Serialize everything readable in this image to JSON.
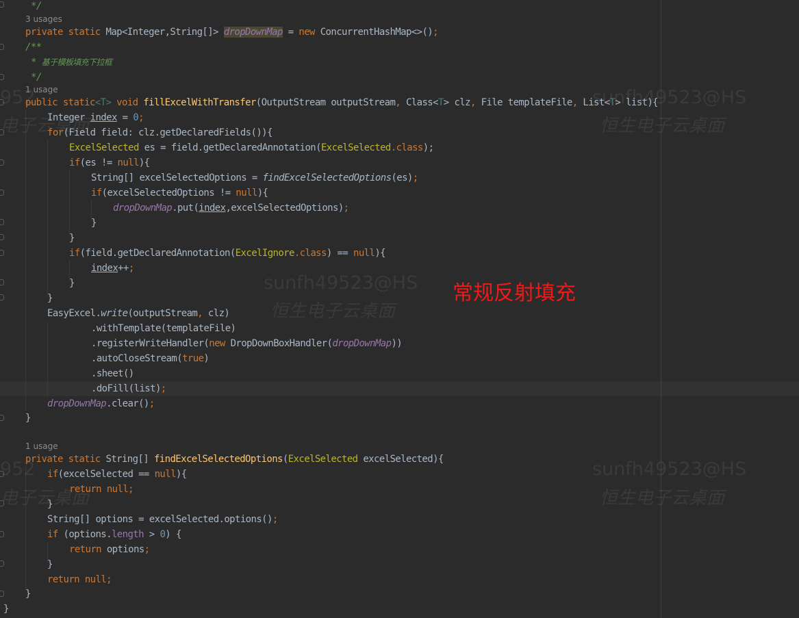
{
  "inlay_hints": {
    "usages_3": "3 usages",
    "usage_1a": "1 usage",
    "usage_1b": "1 usage"
  },
  "code": {
    "l1": "*/",
    "l3_kw1": "private",
    "l3_kw2": "static",
    "l3_type": "Map<Integer,String[]>",
    "l3_field": "dropDownMap",
    "l3_eq": " = ",
    "l3_new": "new",
    "l3_rest": "ConcurrentHashMap<>()",
    "l3_semi": ";",
    "l4": "/**",
    "l5_star": "* ",
    "l5_text": "基于模板填充下拉框",
    "l6": "*/",
    "m1_kw1": "public",
    "m1_kw2": "static",
    "m1_tp1": "<T>",
    "m1_void": "void",
    "m1_name": "fillExcelWithTransfer",
    "m1_args1": "(OutputStream outputStream",
    "m1_comma1": ", ",
    "m1_args2": "Class<",
    "m1_tp2": "T",
    "m1_args3": "> clz",
    "m1_comma2": ", ",
    "m1_args4": "File templateFile",
    "m1_comma3": ", ",
    "m1_args5": "List<",
    "m1_tp3": "T",
    "m1_args6": "> list){",
    "b1_type": "Integer ",
    "b1_var": "index",
    "b1_eq": " = ",
    "b1_num": "0",
    "b1_semi": ";",
    "b2_for": "for",
    "b2_rest": "(Field field: clz.getDeclaredFields()){",
    "b3_ann": "ExcelSelected",
    "b3_mid": " es = field.getDeclaredAnnotation(",
    "b3_ann2": "ExcelSelected",
    "b3_cls": ".class",
    "b3_end": ");",
    "b4_if": "if",
    "b4_mid": "(es != ",
    "b4_null": "null",
    "b4_end": "){",
    "b5_mid": "String[] excelSelectedOptions = ",
    "b5_call": "findExcelSelectedOptions",
    "b5_args": "(es)",
    "b5_semi": ";",
    "b6_if": "if",
    "b6_mid": "(excelSelectedOptions != ",
    "b6_null": "null",
    "b6_end": "){",
    "b7_field": "dropDownMap",
    "b7_mid": ".put(",
    "b7_var": "index",
    "b7_rest": ",excelSelectedOptions)",
    "b7_semi": ";",
    "close": "}",
    "b10_if": "if",
    "b10_mid": "(field.getDeclaredAnnotation(",
    "b10_ann": "ExcelIgnore",
    "b10_cls": ".class",
    "b10_mid2": ") == ",
    "b10_null": "null",
    "b10_end": "){",
    "b11_var": "index",
    "b11_op": "++",
    "b11_semi": ";",
    "e1_cls": "EasyExcel.",
    "e1_write": "write",
    "e1_args": "(outputStream",
    "e1_comma": ", ",
    "e1_end": "clz)",
    "e2": ".withTemplate(templateFile)",
    "e3_a": ".registerWriteHandler(",
    "e3_new": "new",
    "e3_b": " DropDownBoxHandler(",
    "e3_field": "dropDownMap",
    "e3_c": "))",
    "e4_a": ".autoCloseStream(",
    "e4_true": "true",
    "e4_b": ")",
    "e5": ".sheet()",
    "e6_a": ".doFill(list)",
    "e6_semi": ";",
    "e7_field": "dropDownMap",
    "e7_rest": ".clear()",
    "e7_semi": ";",
    "m2_kw1": "private",
    "m2_kw2": "static",
    "m2_type": "String[]",
    "m2_name": "findExcelSelectedOptions",
    "m2_a": "(",
    "m2_ann": "ExcelSelected",
    "m2_b": " excelSelected){",
    "c1_if": "if",
    "c1_mid": "(excelSelected == ",
    "c1_null": "null",
    "c1_end": "){",
    "c2_ret": "return",
    "c2_null": "null",
    "c2_semi": ";",
    "c4_a": "String[] options = excelSelected.options()",
    "c4_semi": ";",
    "c5_if": "if",
    "c5_a": " (options.",
    "c5_len": "length",
    "c5_b": " > ",
    "c5_num": "0",
    "c5_c": ") {",
    "c6_ret": "return",
    "c6_a": " options",
    "c6_semi": ";",
    "c8_ret": "return",
    "c8_null": "null",
    "c8_semi": ";"
  },
  "watermarks": {
    "user": "sunfh49523@HS",
    "desktop": "恒生电子云桌面",
    "user_partial": "952",
    "desktop_partial": "电子云桌面"
  },
  "annotation": {
    "text": "常规反射填充",
    "color": "#f0191a"
  }
}
